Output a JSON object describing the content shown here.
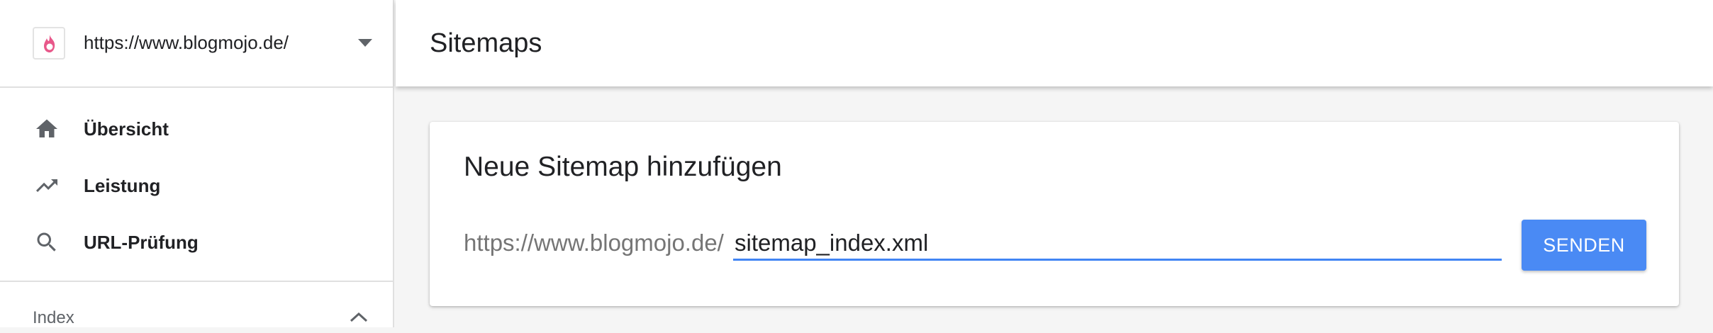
{
  "property": {
    "url": "https://www.blogmojo.de/",
    "logo_icon": "flame-logo-icon",
    "caret_icon": "caret-down-icon"
  },
  "sidebar": {
    "items": [
      {
        "label": "Übersicht",
        "icon": "home-icon"
      },
      {
        "label": "Leistung",
        "icon": "trending-up-icon"
      },
      {
        "label": "URL-Prüfung",
        "icon": "search-icon"
      }
    ],
    "section": {
      "label": "Index",
      "icon": "chevron-up-icon"
    }
  },
  "header": {
    "title": "Sitemaps"
  },
  "card": {
    "title": "Neue Sitemap hinzufügen",
    "prefix": "https://www.blogmojo.de/",
    "input_value": "sitemap_index.xml",
    "send_label": "SENDEN"
  },
  "colors": {
    "accent": "#4285f4",
    "button": "#4a8af4",
    "logo": "#e8588a"
  }
}
